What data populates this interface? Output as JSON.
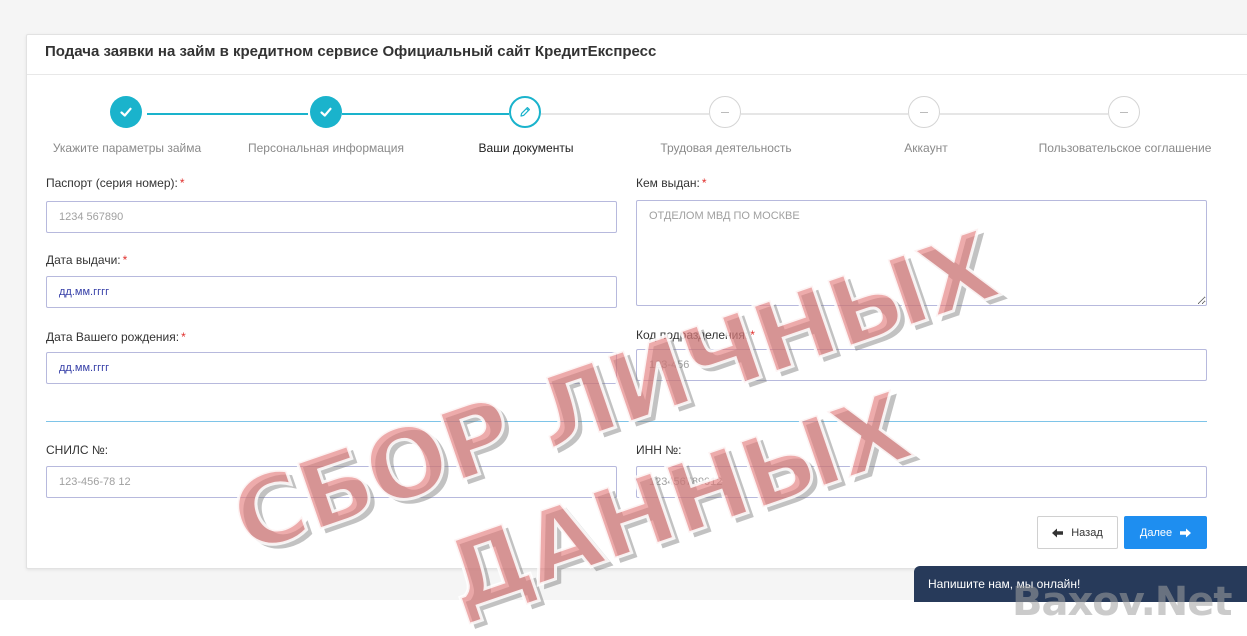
{
  "page": {
    "title": "Подача заявки на займ в кредитном сервисе Официальный сайт КредитЕкспресс"
  },
  "steps": [
    {
      "label": "Укажите параметры займа",
      "state": "done"
    },
    {
      "label": "Персональная информация",
      "state": "done"
    },
    {
      "label": "Ваши документы",
      "state": "active"
    },
    {
      "label": "Трудовая деятельность",
      "state": "pending"
    },
    {
      "label": "Аккаунт",
      "state": "pending"
    },
    {
      "label": "Пользовательское соглашение",
      "state": "pending"
    }
  ],
  "form": {
    "passport_label": "Паспорт (серия номер):",
    "passport_placeholder": "1234 567890",
    "issued_by_label": "Кем выдан:",
    "issued_by_placeholder": "ОТДЕЛОМ МВД ПО МОСКВЕ",
    "issue_date_label": "Дата выдачи:",
    "issue_date_placeholder": "дд.мм.гггг",
    "birth_date_label": "Дата Вашего рождения:",
    "birth_date_placeholder": "дд.мм.гггг",
    "dept_code_label": "Код подразделения:",
    "dept_code_placeholder": "123-456",
    "snils_label": "СНИЛС №:",
    "snils_placeholder": "123-456-78 12",
    "inn_label": "ИНН №:",
    "inn_placeholder": "123456789012",
    "required_mark": "*"
  },
  "buttons": {
    "back": "Назад",
    "next": "Далее"
  },
  "chat": {
    "label": "Напишите нам, мы онлайн!"
  },
  "watermark": {
    "line1": "СБОР ЛИЧНЫХ",
    "line2": "ДАННЫХ",
    "brand": "Baxov.Net"
  },
  "colors": {
    "accent": "#1ab3cc",
    "primary_button": "#1e8ef0",
    "chat_bg": "#273a5a",
    "required": "#e0302d"
  },
  "icons": {
    "step_done": "check-icon",
    "step_active": "pencil-icon",
    "step_pending": "dash-icon",
    "back": "arrow-left-icon",
    "next": "arrow-right-icon"
  }
}
